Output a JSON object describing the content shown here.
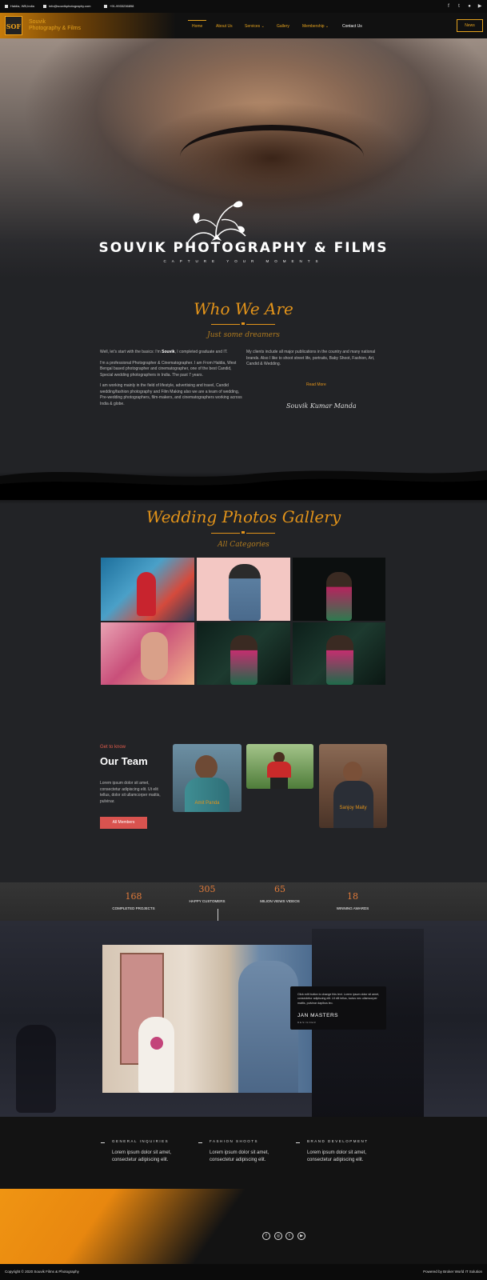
{
  "topbar": {
    "location": "Haldia, WB,India",
    "email": "info@souvikphotography.com",
    "phone": "+91-9933236898"
  },
  "header": {
    "logo_text": "SOF",
    "brand_line1": "Souvik",
    "brand_line2": "Photography & Films",
    "nav": [
      "Home",
      "About Us",
      "Services",
      "Gallery",
      "Membership",
      "Contact Us"
    ],
    "news_button": "News"
  },
  "hero": {
    "title": "SOUVIK PHOTOGRAPHY & FILMS",
    "subtitle": "CAPTURE YOUR MOMENTS"
  },
  "about": {
    "heading": "Who We Are",
    "subheading": "Just some dreamers",
    "para1_prefix": "Well, let's start with the basics: I'm ",
    "para1_name": "Souvik",
    "para1_suffix": ", I completed graduate and IT.",
    "para2": "I'm a professional Photographer & Cinematographer. I am From Haldia, West Bengal based photographer and cinematographer, one of the best Candid, Special wedding photographers in India. The past 7 years.",
    "para3": "I am working mainly in the field of lifestyle, advertising and travel, Candid wedding/fashion photography and Film Making also we are a team of wedding, Pre-wedding photographers, film-makers, and cinematographers working across India & globe.",
    "para4": "My clients include all major publications in the country and many national brands. Also I like to shoot street life, portraits, Baby Shoot, Fashion, Art, Candid & Wedding.",
    "read_more": "Read More",
    "signature": "Souvik Kumar Manda"
  },
  "gallery": {
    "heading": "Wedding Photos Gallery",
    "subheading": "All Categories"
  },
  "team": {
    "kicker": "Get to know",
    "heading": "Our Team",
    "text": "Lorem ipsum dolor sit amet, consectetur adipiscing elit. Ut elit tellus, dolor sit ullamcorper mattis, pulvinar.",
    "button": "All Members",
    "members": [
      "Amit Panda",
      "Sanjoy Maity"
    ]
  },
  "counters": [
    {
      "value": "168",
      "label": "COMPLETED PROJECTS"
    },
    {
      "value": "305",
      "label": "HAPPY CUSTOMERS"
    },
    {
      "value": "65",
      "label": "MILION VIEWS VIDEOS"
    },
    {
      "value": "18",
      "label": "WINNING AWARDS"
    }
  ],
  "testimonial": {
    "text": "Click edit button to change this text. Lorem ipsum dolor sit amet, consectetur adipiscing elit. Ut elit tellus, luctus nec ullamcorper mattis, pulvinar dapibus leo.",
    "name": "JAN MASTERS",
    "role": "DESIGNER"
  },
  "footer_info": [
    {
      "heading": "GENERAL INQUIRIES",
      "text": "Lorem ipsum dolor sit amet, consectetur adipiscing elit."
    },
    {
      "heading": "FASHION SHOOTS",
      "text": "Lorem ipsum dolor sit amet, consectetur adipiscing elit."
    },
    {
      "heading": "BRAND DEVELOPMENT",
      "text": "Lorem ipsum dolor sit amet, consectetur adipiscing elit."
    }
  ],
  "footer": {
    "copyright": "Copyright © 2020 Souvik Films & Photography",
    "powered": "Powered by Broker World IT Solution"
  },
  "icons": [
    "location-icon",
    "email-icon",
    "phone-icon",
    "facebook-icon",
    "twitter-icon",
    "github-icon",
    "youtube-icon",
    "instagram-icon"
  ],
  "colors": {
    "accent": "#e2931a",
    "counter": "#e07a3a",
    "button": "#d9534f"
  }
}
